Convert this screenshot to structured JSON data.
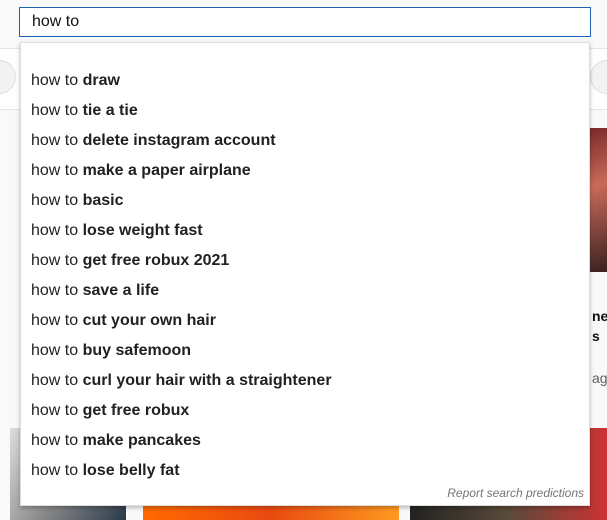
{
  "search": {
    "query": "how to"
  },
  "suggestions": [
    {
      "prefix": "how to ",
      "completion": "draw"
    },
    {
      "prefix": "how to ",
      "completion": "tie a tie"
    },
    {
      "prefix": "how to ",
      "completion": "delete instagram account"
    },
    {
      "prefix": "how to ",
      "completion": "make a paper airplane"
    },
    {
      "prefix": "how to ",
      "completion": "basic"
    },
    {
      "prefix": "how to ",
      "completion": "lose weight fast"
    },
    {
      "prefix": "how to ",
      "completion": "get free robux 2021"
    },
    {
      "prefix": "how to ",
      "completion": "save a life"
    },
    {
      "prefix": "how to ",
      "completion": "cut your own hair"
    },
    {
      "prefix": "how to ",
      "completion": "buy safemoon"
    },
    {
      "prefix": "how to ",
      "completion": "curl your hair with a straightener"
    },
    {
      "prefix": "how to ",
      "completion": "get free robux"
    },
    {
      "prefix": "how to ",
      "completion": "make pancakes"
    },
    {
      "prefix": "how to ",
      "completion": "lose belly fat"
    }
  ],
  "report_label": "Report search predictions",
  "background": {
    "fragment1": "ne",
    "fragment2": "s",
    "fragment3": "ag"
  },
  "colors": {
    "focus_border": "#1c62b9"
  }
}
